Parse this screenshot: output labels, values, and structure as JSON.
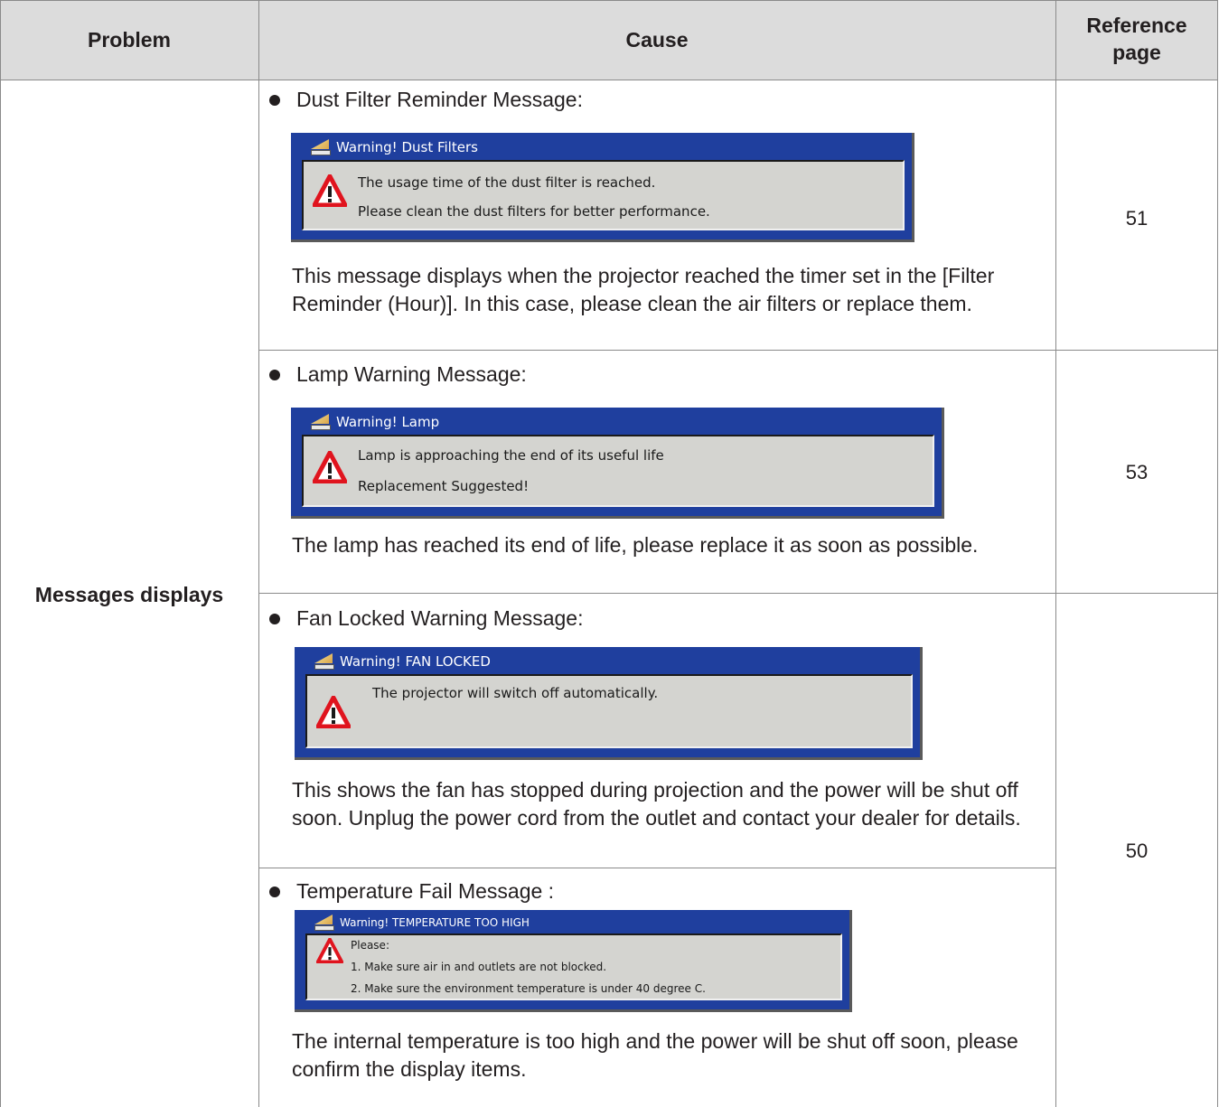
{
  "table": {
    "headers": {
      "problem": "Problem",
      "cause": "Cause",
      "reference_line1": "Reference",
      "reference_line2": "page"
    },
    "problem_label": "Messages displays",
    "rows": [
      {
        "bullet": "Dust Filter Reminder Message:",
        "dialog": {
          "title": "Warning! Dust Filters",
          "lines": [
            "The usage time of the dust filter is reached.",
            "Please clean the dust filters for better performance."
          ]
        },
        "description": "This message displays when the projector reached the timer set in the [Filter Reminder (Hour)]. In this case, please clean the air filters or replace them.",
        "reference": "51"
      },
      {
        "bullet": "Lamp Warning Message:",
        "dialog": {
          "title": "Warning! Lamp",
          "lines": [
            "Lamp is approaching the end of its useful life",
            "Replacement Suggested!"
          ]
        },
        "description": "The lamp has reached its end of life, please replace it as soon as possible.",
        "reference": "53"
      },
      {
        "bullet": "Fan Locked Warning Message:",
        "dialog": {
          "title": "Warning! FAN LOCKED",
          "lines": [
            "The projector will switch off automatically."
          ]
        },
        "description": "This shows the fan has stopped during projection and the power will be shut off soon. Unplug the power cord from the outlet and contact your dealer for details.",
        "reference": "50"
      },
      {
        "bullet": "Temperature Fail Message :",
        "dialog": {
          "title": "Warning! TEMPERATURE TOO HIGH",
          "lines": [
            "Please:",
            "1. Make sure air in and outlets are not blocked.",
            "2. Make sure the environment temperature is under 40 degree C."
          ]
        },
        "description": "The internal temperature is too high and the power will be shut off soon, please confirm the display items."
      }
    ]
  },
  "colors": {
    "header_bg": "#dcdcdc",
    "dialog_blue": "#1f3f9e",
    "dialog_body": "#d4d4d0",
    "warning_red": "#e0141e"
  },
  "icons": {
    "dialog_title": "projector-icon",
    "dialog_alert": "warning-triangle-icon"
  }
}
